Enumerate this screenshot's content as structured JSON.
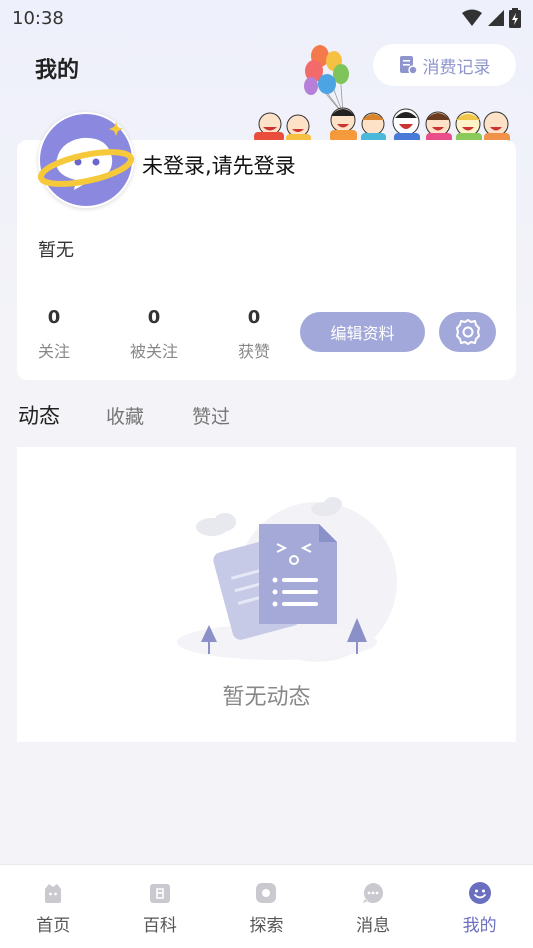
{
  "status_bar": {
    "time": "10:38"
  },
  "header": {
    "title": "我的",
    "records_label": "消费记录"
  },
  "profile": {
    "login_prompt": "未登录,请先登录",
    "bio": "暂无",
    "stats": [
      {
        "value": "0",
        "label": "关注"
      },
      {
        "value": "0",
        "label": "被关注"
      },
      {
        "value": "0",
        "label": "获赞"
      }
    ],
    "edit_label": "编辑资料"
  },
  "tabs": [
    {
      "label": "动态",
      "active": true
    },
    {
      "label": "收藏",
      "active": false
    },
    {
      "label": "赞过",
      "active": false
    }
  ],
  "feed": {
    "empty_text": "暂无动态"
  },
  "tabbar": [
    {
      "label": "首页",
      "icon": "home-icon"
    },
    {
      "label": "百科",
      "icon": "encyclopedia-icon"
    },
    {
      "label": "探索",
      "icon": "explore-icon"
    },
    {
      "label": "消息",
      "icon": "message-icon"
    },
    {
      "label": "我的",
      "icon": "profile-icon",
      "active": true
    }
  ],
  "colors": {
    "accent": "#a2a8d9",
    "active_tab": "#6b6fc0",
    "background": "#f3f3f8"
  }
}
